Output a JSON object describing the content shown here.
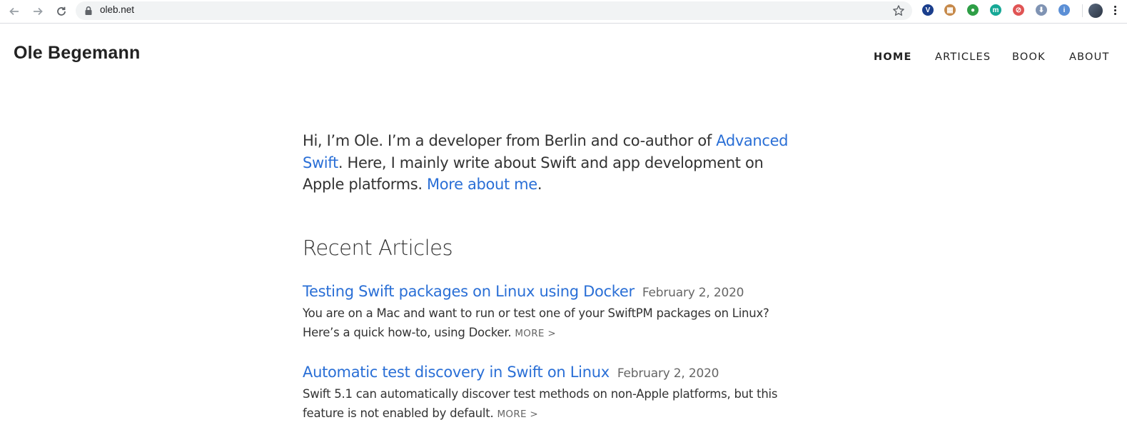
{
  "browser": {
    "url": "oleb.net",
    "extensions": [
      {
        "name": "vimeo-extension-icon",
        "glyph": "V",
        "color": "#1a3e8c"
      },
      {
        "name": "toolbox-extension-icon",
        "glyph": "▦",
        "color": "#c6894a"
      },
      {
        "name": "pushbullet-extension-icon",
        "glyph": "●",
        "color": "#2e9e46"
      },
      {
        "name": "m-extension-icon",
        "glyph": "m",
        "color": "#16a896"
      },
      {
        "name": "blocker-extension-icon",
        "glyph": "⊘",
        "color": "#e05454"
      },
      {
        "name": "download-extension-icon",
        "glyph": "⬇",
        "color": "#7f93b3"
      },
      {
        "name": "info-extension-icon",
        "glyph": "i",
        "color": "#5b8fd6"
      }
    ]
  },
  "site": {
    "title": "Ole Begemann",
    "nav": [
      {
        "label": "HOME",
        "active": true
      },
      {
        "label": "ARTICLES",
        "active": false
      },
      {
        "label": "BOOK",
        "active": false
      },
      {
        "label": "ABOUT",
        "active": false
      }
    ]
  },
  "intro": {
    "before": "Hi, I’m Ole. I’m a developer from Berlin and co-author of ",
    "book_link": "Advanced Swift",
    "middle": ". Here, I mainly write about Swift and app development on Apple platforms. ",
    "about_link": "More about me",
    "after": "."
  },
  "recent": {
    "heading": "Recent Articles",
    "more_label": "MORE >",
    "articles": [
      {
        "title": "Testing Swift packages on Linux using Docker",
        "date": "February 2, 2020",
        "summary": "You are on a Mac and want to run or test one of your SwiftPM packages on Linux? Here’s a quick how-to, using Docker."
      },
      {
        "title": "Automatic test discovery in Swift on Linux",
        "date": "February 2, 2020",
        "summary": "Swift 5.1 can automatically discover test methods on non-Apple platforms, but this feature is not enabled by default."
      }
    ]
  },
  "colors": {
    "link": "#2a6fd6",
    "text": "#333333",
    "date": "#666666"
  }
}
